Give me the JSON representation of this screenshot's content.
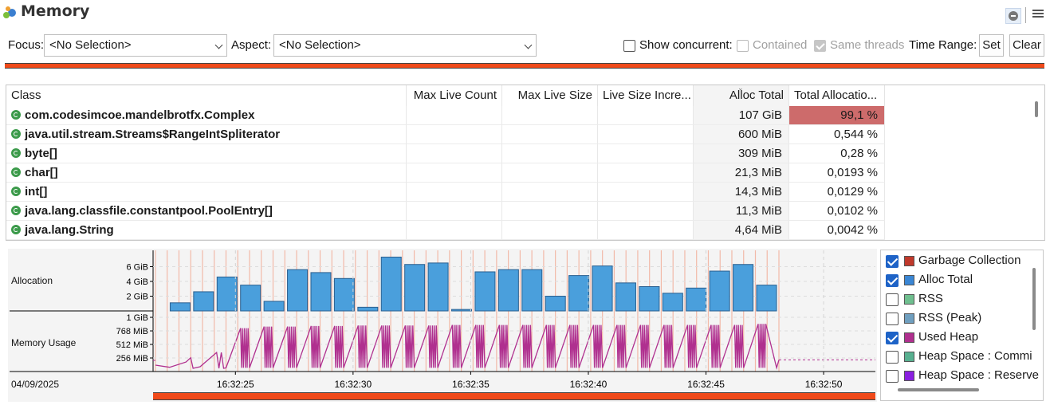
{
  "header": {
    "title": "Memory"
  },
  "toolbar": {
    "focus_label": "Focus:",
    "focus_value": "<No Selection>",
    "aspect_label": "Aspect:",
    "aspect_value": "<No Selection>",
    "show_concurrent_label": "Show concurrent:",
    "show_concurrent_checked": false,
    "contained_label": "Contained",
    "contained_checked": false,
    "same_threads_label": "Same threads",
    "same_threads_checked": true,
    "time_range_label": "Time Range:",
    "set_label": "Set",
    "clear_label": "Clear"
  },
  "table": {
    "columns": [
      "Class",
      "Max Live Count",
      "Max Live Size",
      "Live Size Incre...",
      "Alloc Total",
      "Total Allocatio..."
    ],
    "sorted_column": "Alloc Total",
    "rows": [
      {
        "cls": "com.codesimcoe.mandelbrotfx.Complex",
        "alloc_total": "107 GiB",
        "total_alloc_pct": "99,1 %"
      },
      {
        "cls": "java.util.stream.Streams$RangeIntSpliterator",
        "alloc_total": "600 MiB",
        "total_alloc_pct": "0,544 %"
      },
      {
        "cls": "byte[]",
        "alloc_total": "309 MiB",
        "total_alloc_pct": "0,28 %"
      },
      {
        "cls": "char[]",
        "alloc_total": "21,3 MiB",
        "total_alloc_pct": "0,0193 %"
      },
      {
        "cls": "int[]",
        "alloc_total": "14,3 MiB",
        "total_alloc_pct": "0,0129 %"
      },
      {
        "cls": "java.lang.classfile.constantpool.PoolEntry[]",
        "alloc_total": "11,3 MiB",
        "total_alloc_pct": "0,0102 %"
      },
      {
        "cls": "java.lang.String",
        "alloc_total": "4,64 MiB",
        "total_alloc_pct": "0,0042 %"
      }
    ],
    "highlight_color": "#cd6b6b"
  },
  "chart_data": [
    {
      "type": "bar",
      "title": "Allocation",
      "series": [
        {
          "name": "Alloc Total",
          "values": [
            1.1,
            2.6,
            4.6,
            3.5,
            1.3,
            5.6,
            5.2,
            4.4,
            0.5,
            7.3,
            6.3,
            6.5,
            0.2,
            5.3,
            5.6,
            5.6,
            2.0,
            4.8,
            6.1,
            3.8,
            3.3,
            2.4,
            3.1,
            5.4,
            6.3,
            3.5
          ]
        }
      ],
      "yticks": [
        "2 GiB",
        "4 GiB",
        "6 GiB"
      ],
      "ylim": [
        0,
        8
      ],
      "unit": "GiB"
    },
    {
      "type": "line",
      "title": "Memory Usage",
      "series": [
        {
          "name": "Used Heap",
          "x": [
            "16:32:21",
            "16:32:22",
            "16:32:23",
            "16:32:24",
            "16:32:25",
            "16:32:26",
            "16:32:27",
            "16:32:28",
            "16:32:29",
            "16:32:30",
            "16:32:31",
            "16:32:32",
            "16:32:33",
            "16:32:34",
            "16:32:35",
            "16:32:36",
            "16:32:37",
            "16:32:38",
            "16:32:39",
            "16:32:40",
            "16:32:41",
            "16:32:42",
            "16:32:43",
            "16:32:44",
            "16:32:45",
            "16:32:46",
            "16:32:47",
            "16:32:48"
          ],
          "values": [
            150,
            100,
            400,
            560,
            820,
            850,
            850,
            860,
            860,
            870,
            870,
            870,
            870,
            880,
            880,
            880,
            880,
            880,
            880,
            880,
            880,
            880,
            880,
            880,
            880,
            880,
            900,
            210
          ]
        }
      ],
      "yticks": [
        "256 MiB",
        "512 MiB",
        "768 MiB",
        "1 GiB"
      ],
      "ylim": [
        0,
        1100
      ],
      "unit": "MiB"
    }
  ],
  "time_axis": {
    "date": "04/09/2025",
    "ticks": [
      "16:32:25",
      "16:32:30",
      "16:32:35",
      "16:32:40",
      "16:32:45",
      "16:32:50"
    ]
  },
  "legend": {
    "items": [
      {
        "label": "Garbage Collection",
        "checked": true,
        "color": "#c0392b",
        "icon": "garbage-collection-icon"
      },
      {
        "label": "Alloc Total",
        "checked": true,
        "color": "#3a86d4",
        "icon": "alloc-total-swatch"
      },
      {
        "label": "RSS",
        "checked": false,
        "color": "#6fbf8f",
        "icon": "rss-swatch"
      },
      {
        "label": "RSS (Peak)",
        "checked": false,
        "color": "#6f9fbf",
        "icon": "rss-peak-swatch"
      },
      {
        "label": "Used Heap",
        "checked": true,
        "color": "#b0308f",
        "icon": "used-heap-swatch"
      },
      {
        "label": "Heap Space : Commi",
        "checked": false,
        "color": "#58b090",
        "icon": "heap-committed-swatch"
      },
      {
        "label": "Heap Space : Reserve",
        "checked": false,
        "color": "#8a20e0",
        "icon": "heap-reserved-swatch"
      }
    ]
  },
  "colors": {
    "accent_orange": "#f04a1a",
    "bar_fill": "#4a9fdc",
    "heap_line": "#b0308f",
    "gc_marker": "#f2b9a8"
  }
}
